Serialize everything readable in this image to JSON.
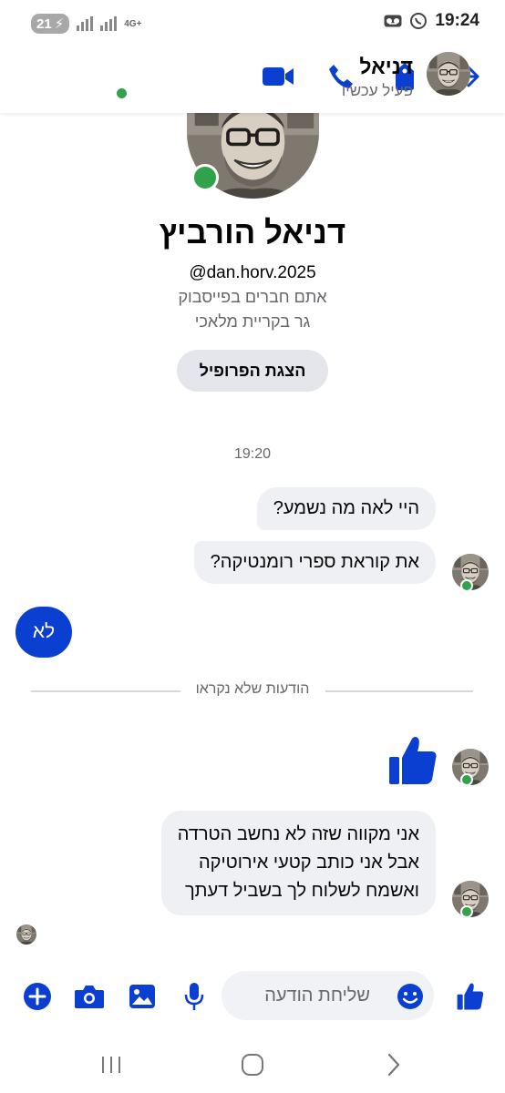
{
  "status_bar": {
    "battery": "21",
    "network": "4G+",
    "time": "19:24"
  },
  "header": {
    "name": "דניאל",
    "status": "פעיל עכשיו",
    "icons": [
      "video-call-icon",
      "phone-call-icon",
      "tag-icon",
      "forward-arrow-icon"
    ]
  },
  "profile": {
    "name": "דניאל הורביץ",
    "handle": "@dan.horv.2025",
    "friends_text": "אתם חברים בפייסבוק",
    "location_text": "גר בקריית מלאכי",
    "view_profile_button": "הצגת הפרופיל"
  },
  "conversation": {
    "timestamp": "19:20",
    "incoming_1": "היי לאה מה נשמע?",
    "incoming_2": "את קוראת ספרי רומנטיקה?",
    "outgoing_1": "לא",
    "unread_divider": "הודעות שלא נקראו",
    "incoming_like": "thumbs-up-icon",
    "incoming_3": [
      "אני מקווה שזה לא נחשב הטרדה",
      "אבל אני כותב קטעי אירוטיקה",
      "ואשמח לשלוח לך בשביל דעתך"
    ]
  },
  "composer": {
    "placeholder": "שליחת הודעה",
    "icons": [
      "plus-icon",
      "camera-icon",
      "gallery-icon",
      "microphone-icon",
      "emoji-icon",
      "like-icon"
    ]
  },
  "colors": {
    "accent": "#0a3fd1",
    "online": "#31a24c",
    "bubble_gray": "#eff0f4"
  }
}
